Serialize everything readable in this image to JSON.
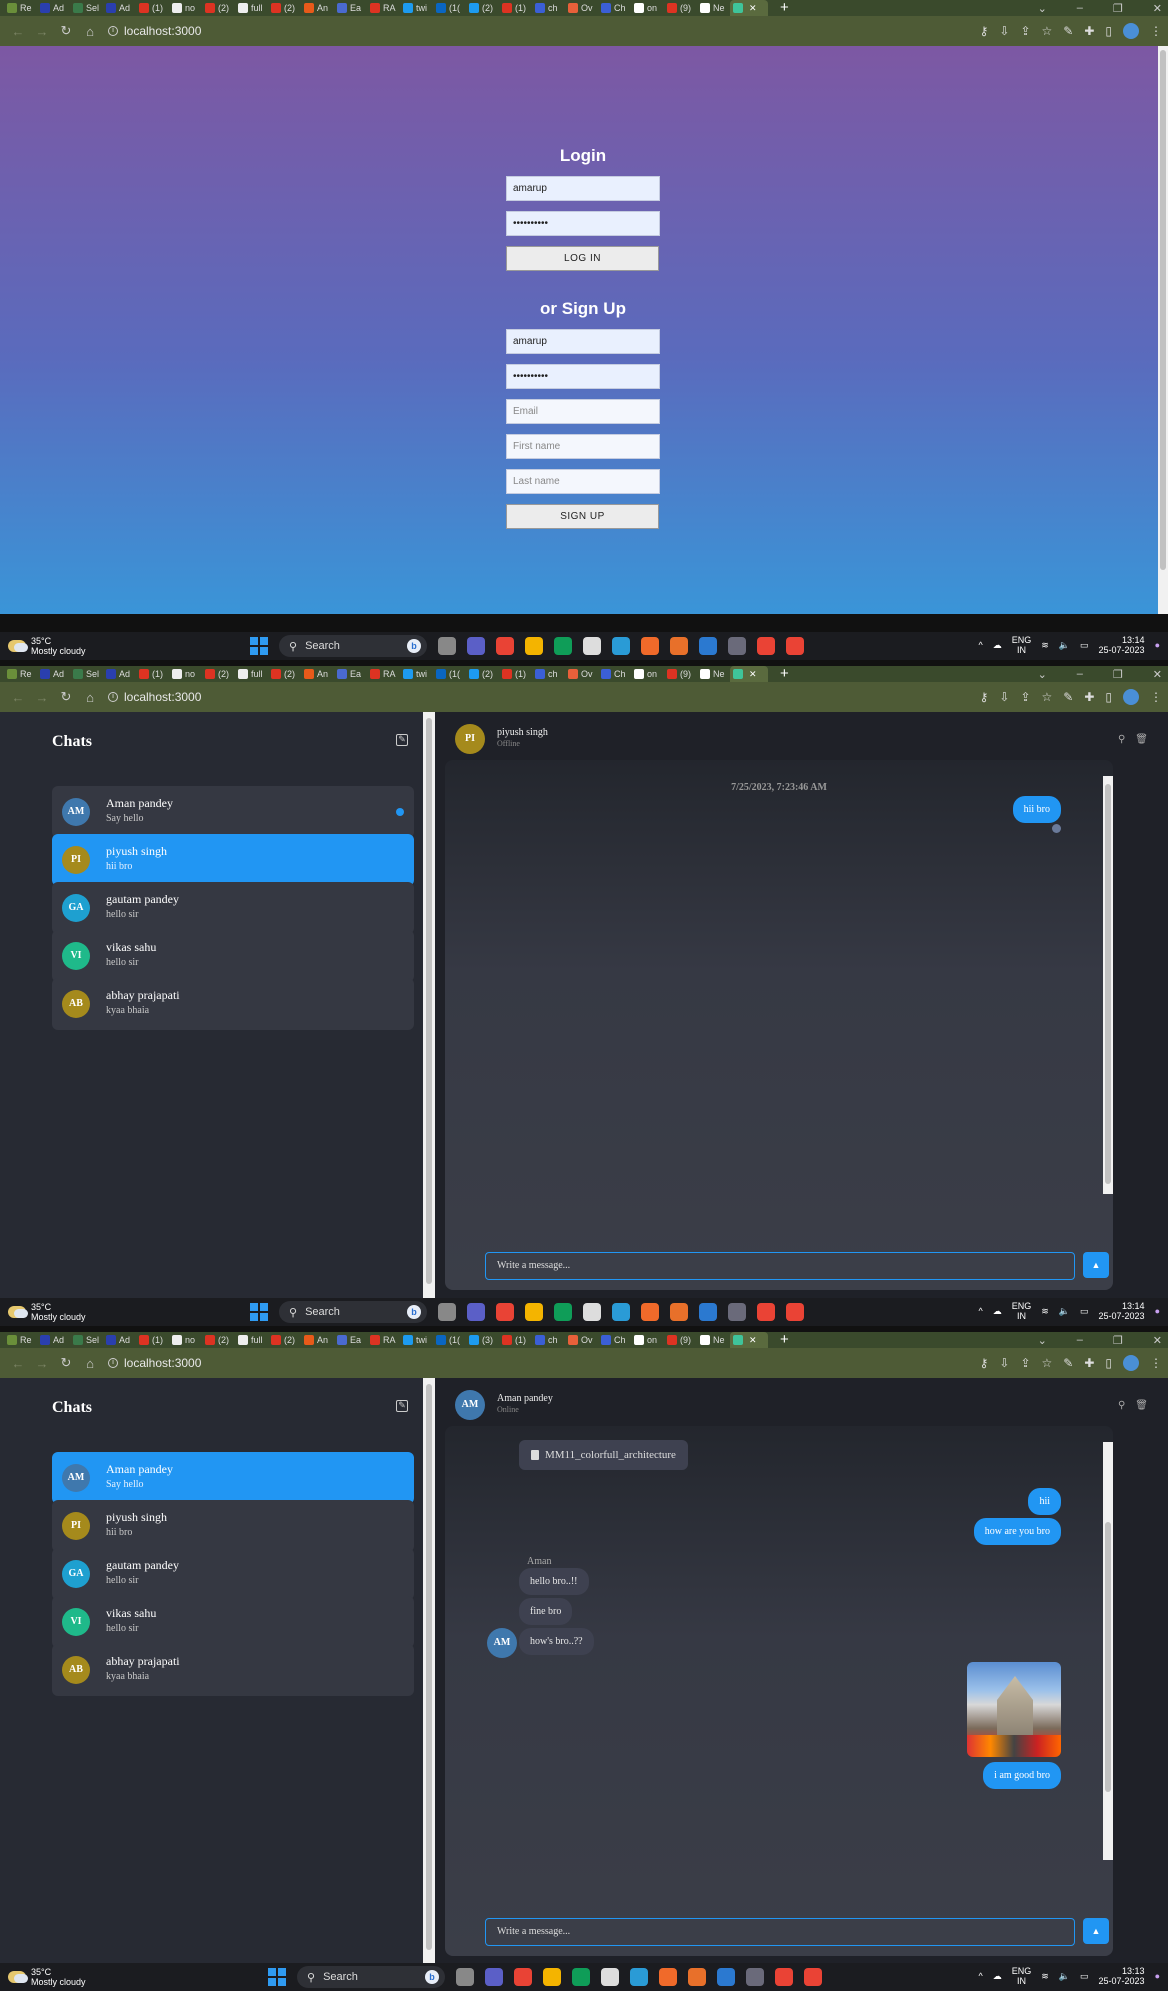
{
  "browser": {
    "tabs": [
      "Re",
      "Ad",
      "Sel",
      "Ad",
      "(1)",
      "no",
      "(2)",
      "full",
      "(2)",
      "An",
      "Ea",
      "RA",
      "twi",
      "(1(",
      "(2)",
      "(1)",
      "ch",
      "Ov",
      "Ch",
      "on",
      "(9)",
      "Ne"
    ],
    "tabs_s3": [
      "Re",
      "Ad",
      "Sel",
      "Ad",
      "(1)",
      "no",
      "(2)",
      "full",
      "(2)",
      "An",
      "Ea",
      "RA",
      "twi",
      "(1(",
      "(3)",
      "(1)",
      "ch",
      "Ov",
      "Ch",
      "on",
      "(9)",
      "Ne"
    ],
    "url": "localhost:3000",
    "new_tab": "+"
  },
  "taskbar": {
    "temp": "35°C",
    "weather": "Mostly cloudy",
    "search": "Search",
    "lang1": "ENG",
    "lang2": "IN",
    "time1": "13:14",
    "time3": "13:13",
    "date": "25-07-2023"
  },
  "login": {
    "title": "Login",
    "username": "amarup",
    "password": "••••••••••",
    "login_button": "LOG IN",
    "signup_title": "or Sign Up",
    "signup_username": "amarup",
    "signup_password": "••••••••••",
    "email_placeholder": "Email",
    "first_name_placeholder": "First name",
    "last_name_placeholder": "Last name",
    "signup_button": "SIGN UP"
  },
  "chats": {
    "title": "Chats",
    "list": [
      {
        "initials": "AM",
        "name": "Aman pandey",
        "last": "Say hello",
        "color": "#3f78ad"
      },
      {
        "initials": "PI",
        "name": "piyush singh",
        "last": "hii bro",
        "color": "#a58a1c"
      },
      {
        "initials": "GA",
        "name": "gautam pandey",
        "last": "hello sir",
        "color": "#1ea0d0"
      },
      {
        "initials": "VI",
        "name": "vikas sahu",
        "last": "hello sir",
        "color": "#1fb98a"
      },
      {
        "initials": "AB",
        "name": "abhay prajapati",
        "last": "kyaa bhaia",
        "color": "#a58a1c"
      }
    ]
  },
  "conv1": {
    "name": "piyush singh",
    "status": "Offline",
    "initials": "PI",
    "timestamp": "7/25/2023, 7:23:46 AM",
    "messages": [
      "hii bro"
    ],
    "placeholder": "Write a message..."
  },
  "conv2": {
    "name": "Aman pandey",
    "status": "Online",
    "initials": "AM",
    "file": "MM11_colorfull_architecture",
    "out1": "hii",
    "out2": "how are you bro",
    "sender": "Aman",
    "in1": "hello bro..!!",
    "in2": "fine bro",
    "in3": "how's bro..??",
    "out3": "i am good bro",
    "placeholder": "Write a message..."
  }
}
